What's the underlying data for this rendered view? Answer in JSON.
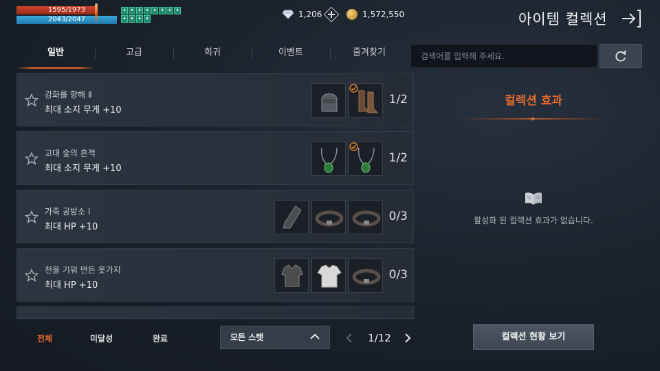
{
  "status": {
    "hp_text": "1595/1973",
    "hp_fraction": 0.808,
    "mp_text": "2043/2047",
    "mp_fraction": 0.998,
    "buff_icons": [
      "buff-1",
      "buff-2",
      "buff-3",
      "buff-4",
      "buff-5",
      "buff-6",
      "buff-7",
      "buff-8",
      "buff-9",
      "buff-10",
      "buff-11",
      "buff-12"
    ]
  },
  "currency": {
    "diamonds": "1,206",
    "gold": "1,572,550"
  },
  "header": {
    "title": "아이템 컬렉션",
    "exit_icon": "exit-arrow-icon"
  },
  "tabs": [
    {
      "label": "일반",
      "active": true
    },
    {
      "label": "고급",
      "active": false
    },
    {
      "label": "희귀",
      "active": false
    },
    {
      "label": "이벤트",
      "active": false
    },
    {
      "label": "즐겨찾기",
      "active": false
    }
  ],
  "search": {
    "placeholder": "검색어를 입력해 주세요.",
    "refresh_icon": "refresh-icon"
  },
  "collections": [
    {
      "name": "강화를 향해 Ⅱ",
      "effect": "최대 소지 무게 +10",
      "progress": "1/2",
      "items": [
        {
          "icon": "helmet-icon",
          "owned": false
        },
        {
          "icon": "boots-icon",
          "owned": true
        }
      ]
    },
    {
      "name": "고대 숲의 흔적",
      "effect": "최대 소지 무게 +10",
      "progress": "1/2",
      "items": [
        {
          "icon": "necklace-icon",
          "owned": false
        },
        {
          "icon": "necklace-icon",
          "owned": true
        }
      ]
    },
    {
      "name": "가죽 공방소 Ⅰ",
      "effect": "최대 HP +10",
      "progress": "0/3",
      "items": [
        {
          "icon": "gauntlet-icon",
          "owned": false
        },
        {
          "icon": "belt-icon",
          "owned": false
        },
        {
          "icon": "belt-icon",
          "owned": false
        }
      ]
    },
    {
      "name": "천을 기워 만든 옷가지",
      "effect": "최대 HP +10",
      "progress": "0/3",
      "items": [
        {
          "icon": "armor-icon",
          "owned": false
        },
        {
          "icon": "shirt-icon",
          "owned": false
        },
        {
          "icon": "belt-icon",
          "owned": false
        }
      ]
    }
  ],
  "filters": [
    {
      "label": "전체",
      "active": true
    },
    {
      "label": "미달성",
      "active": false
    },
    {
      "label": "완료",
      "active": false
    }
  ],
  "stat_select": {
    "value": "모든 스탯"
  },
  "pager": {
    "text": "1/12"
  },
  "effects_panel": {
    "title": "컬렉션 효과",
    "empty_text": "활성화 된 컬렉션 효과가 없습니다.",
    "button_label": "컬렉션 현황 보기"
  },
  "colors": {
    "accent": "#e36a2c",
    "hp": "#c9442b",
    "mp": "#3aa7d9",
    "buff": "#1f8a6d"
  }
}
